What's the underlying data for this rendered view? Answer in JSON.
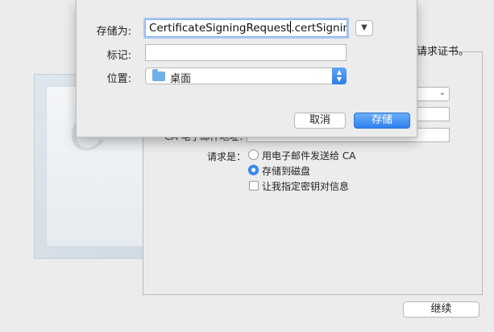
{
  "background": {
    "description_tail": "请求证书。",
    "ca_email_label": "CA 电子邮件地址：",
    "request_label": "请求是：",
    "options": [
      {
        "label": "用电子邮件发送给 CA",
        "selected": false
      },
      {
        "label": "存储到磁盘",
        "selected": true
      }
    ],
    "checkbox_label": "让我指定密钥对信息",
    "continue_label": "继续"
  },
  "save_sheet": {
    "save_as_label": "存储为:",
    "save_as_value": "CertificateSigningRequest",
    "save_as_ext": ".certSigningRe",
    "tags_label": "标记:",
    "tags_value": "",
    "where_label": "位置:",
    "where_value": "桌面",
    "expand_icon": "chevron-down-icon",
    "cancel_label": "取消",
    "save_label": "存储"
  },
  "colors": {
    "accent": "#2f80ef",
    "selected_radio": "#3b8df0",
    "folder": "#6fb0e8"
  }
}
